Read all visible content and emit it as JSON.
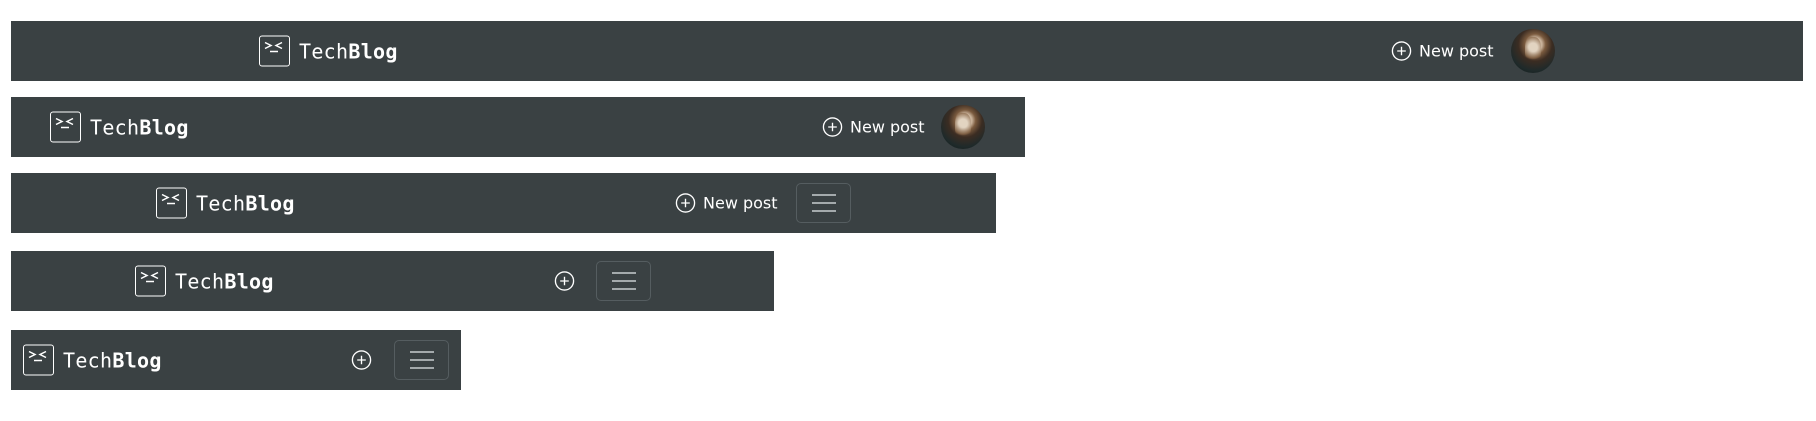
{
  "brand": {
    "prefix": "Tech",
    "emphasis": "Blog"
  },
  "actions": {
    "new_post_label": "New post"
  },
  "icons": {
    "logo": "terminal-face-icon",
    "new_post": "plus-circle-icon",
    "menu": "hamburger-menu-icon",
    "avatar": "cat-avatar"
  },
  "colors": {
    "navbar_bg": "#3a4143",
    "text": "#ffffff",
    "toggler_border": "#555d60"
  }
}
